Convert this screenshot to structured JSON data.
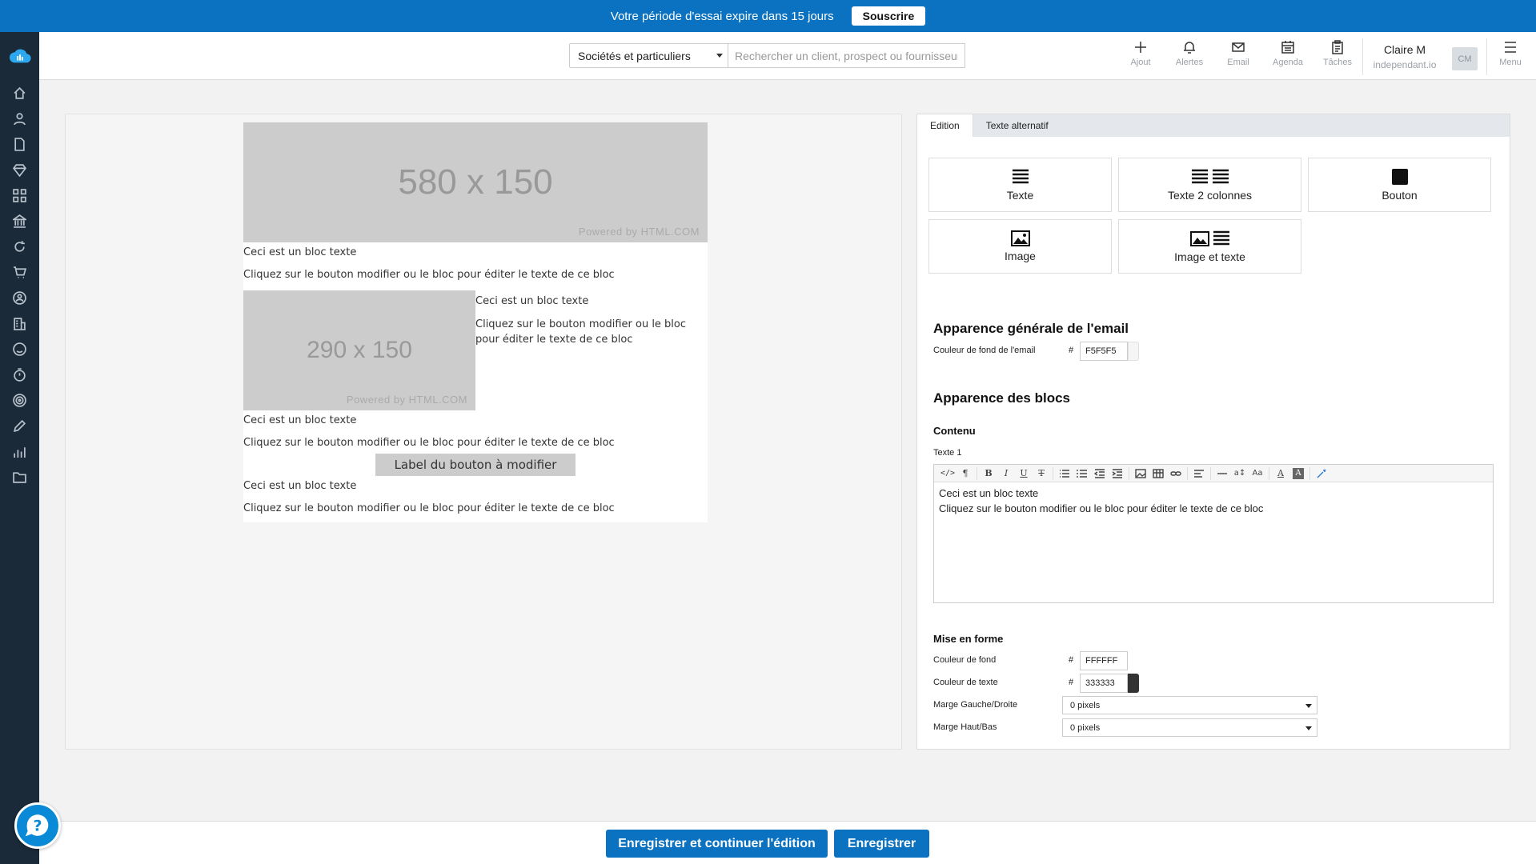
{
  "trial": {
    "message": "Votre période d'essai expire dans 15 jours",
    "subscribe_label": "Souscrire"
  },
  "header": {
    "search_scope": "Sociétés et particuliers",
    "search_placeholder": "Rechercher un client, prospect ou fournisseur",
    "tools": [
      {
        "label": "Ajout",
        "icon": "plus-icon"
      },
      {
        "label": "Alertes",
        "icon": "bell-icon"
      },
      {
        "label": "Email",
        "icon": "envelope-icon"
      },
      {
        "label": "Agenda",
        "icon": "calendar-icon"
      },
      {
        "label": "Tâches",
        "icon": "clipboard-icon"
      }
    ],
    "user_name": "Claire M",
    "user_org": "independant.io",
    "avatar_initials": "CM",
    "menu_label": "Menu"
  },
  "sidebar": {
    "items": [
      "home-icon",
      "user-icon",
      "document-icon",
      "diamond-icon",
      "grid-icon",
      "bank-icon",
      "refresh-icon",
      "cart-icon",
      "contact-icon",
      "building-icon",
      "smiley-icon",
      "timer-icon",
      "target-icon",
      "pencil-icon",
      "chart-icon",
      "folder-icon"
    ]
  },
  "email": {
    "banner_image": {
      "size_label": "580 x 150",
      "powered": "Powered by HTML.COM"
    },
    "block1": {
      "title": "Ceci est un bloc texte",
      "body": "Cliquez sur le bouton modifier ou le bloc pour éditer le texte de ce bloc"
    },
    "side_image": {
      "size_label": "290 x 150",
      "powered": "Powered by HTML.COM"
    },
    "block2": {
      "title": "Ceci est un bloc texte",
      "body": "Cliquez sur le bouton modifier ou le bloc pour éditer le texte de ce bloc"
    },
    "block3": {
      "title": "Ceci est un bloc texte",
      "body": "Cliquez sur le bouton modifier ou le bloc pour éditer le texte de ce bloc"
    },
    "button_label": "Label du bouton à modifier",
    "block4": {
      "title": "Ceci est un bloc texte",
      "body": "Cliquez sur le bouton modifier ou le bloc pour éditer le texte de ce bloc"
    }
  },
  "panel": {
    "tabs": [
      "Edition",
      "Texte alternatif"
    ],
    "blocks": [
      "Texte",
      "Texte 2 colonnes",
      "Bouton",
      "Image",
      "Image et texte"
    ],
    "general_title": "Apparence générale de l'email",
    "bg_color_label": "Couleur de fond de l'email",
    "bg_color_value": "F5F5F5",
    "blocks_title": "Apparence des blocs",
    "content_title": "Contenu",
    "text1_label": "Texte 1",
    "editor_line1": "Ceci est un bloc texte",
    "editor_line2": "Cliquez sur le bouton modifier ou le bloc pour éditer le texte de ce bloc",
    "format_title": "Mise en forme",
    "block_bg_label": "Couleur de fond",
    "block_bg_value": "FFFFFF",
    "text_color_label": "Couleur de texte",
    "text_color_value": "333333",
    "margin_lr_label": "Marge Gauche/Droite",
    "margin_lr_value": "0 pixels",
    "margin_tb_label": "Marge Haut/Bas",
    "margin_tb_value": "0 pixels",
    "hash": "#"
  },
  "footer": {
    "save_continue_label": "Enregistrer et continuer l'édition",
    "save_label": "Enregistrer"
  },
  "colors": {
    "brand": "#0a72c0",
    "sidebar": "#1b2a38",
    "placeholder": "#cccccc",
    "swatch_text": "#333333"
  }
}
